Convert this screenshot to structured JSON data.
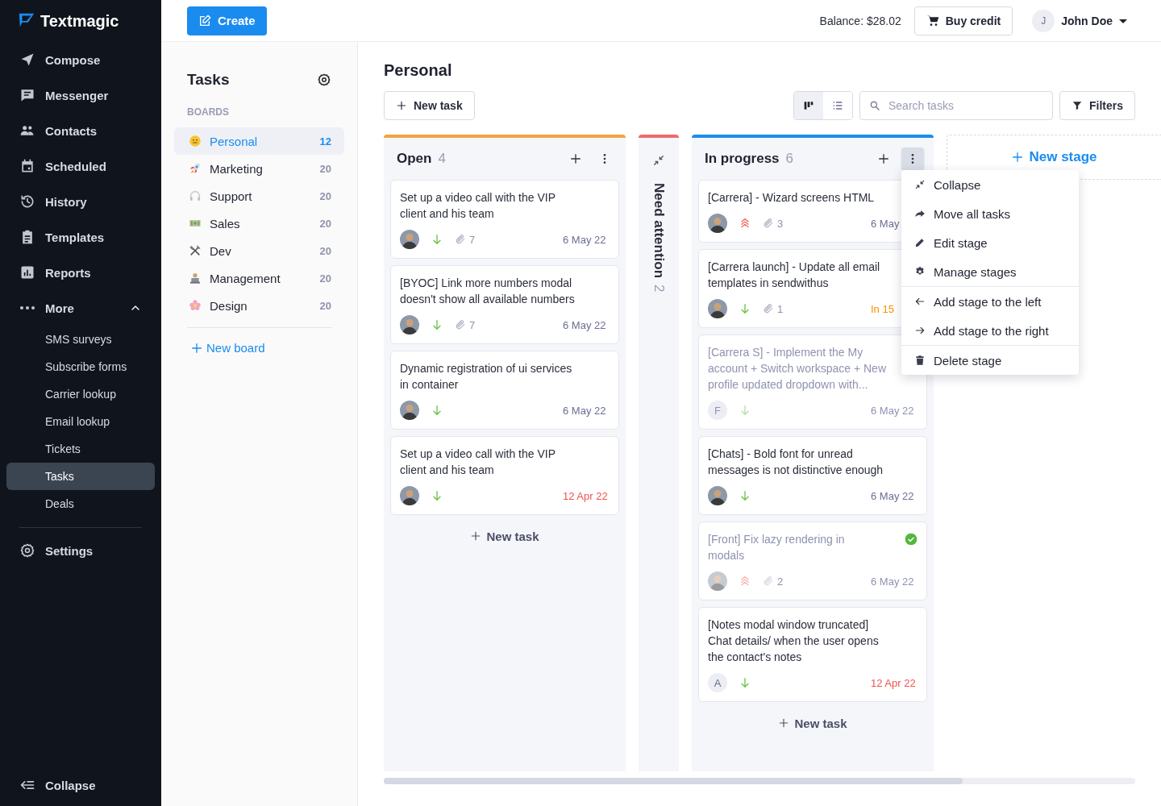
{
  "sidebar": {
    "logo": "Textmagic",
    "items": [
      {
        "label": "Compose",
        "selected": false
      },
      {
        "label": "Messenger",
        "selected": false
      },
      {
        "label": "Contacts",
        "selected": false
      },
      {
        "label": "Scheduled",
        "selected": false
      },
      {
        "label": "History",
        "selected": false
      },
      {
        "label": "Templates",
        "selected": false
      },
      {
        "label": "Reports",
        "selected": false
      },
      {
        "label": "More",
        "selected": false,
        "expanded": true,
        "children": [
          {
            "label": "SMS surveys",
            "selected": false
          },
          {
            "label": "Subscribe forms",
            "selected": false
          },
          {
            "label": "Carrier lookup",
            "selected": false
          },
          {
            "label": "Email lookup",
            "selected": false
          },
          {
            "label": "Tickets",
            "selected": false
          },
          {
            "label": "Tasks",
            "selected": true
          },
          {
            "label": "Deals",
            "selected": false
          }
        ]
      }
    ],
    "settings": "Settings",
    "collapse": "Collapse"
  },
  "topbar": {
    "create": "Create",
    "balance": "Balance: $28.02",
    "buy_credit": "Buy credit",
    "user": {
      "initial": "J",
      "name": "John Doe"
    }
  },
  "boards_panel": {
    "title": "Tasks",
    "section": "BOARDS",
    "boards": [
      {
        "name": "Personal",
        "count": "12",
        "selected": true
      },
      {
        "name": "Marketing",
        "count": "20",
        "selected": false
      },
      {
        "name": "Support",
        "count": "20",
        "selected": false
      },
      {
        "name": "Sales",
        "count": "20",
        "selected": false
      },
      {
        "name": "Dev",
        "count": "20",
        "selected": false
      },
      {
        "name": "Management",
        "count": "20",
        "selected": false
      },
      {
        "name": "Design",
        "count": "20",
        "selected": false
      }
    ],
    "new_board": "New board"
  },
  "board": {
    "title": "Personal",
    "new_task": "New task",
    "views": [
      {
        "selected": true
      },
      {
        "selected": false
      }
    ],
    "search": {
      "placeholder": "Search tasks"
    },
    "filters": "Filters",
    "columns": [
      {
        "name": "Open",
        "count": "4",
        "color": "#f2a241",
        "collapsed": false,
        "menu_open": false,
        "new_task": "New task",
        "cards": [
          {
            "title": "Set up a video call with the VIP client and his team",
            "assignee": {
              "kind": "photo"
            },
            "high_priority": false,
            "attachments": "7",
            "date": "6 May 22",
            "overdue": false,
            "due_soon": false,
            "dimmed": false,
            "completed": false
          },
          {
            "title": "[BYOC] Link more numbers modal doesn't show all available numbers",
            "assignee": {
              "kind": "photo"
            },
            "high_priority": false,
            "attachments": "7",
            "date": "6 May 22",
            "overdue": false,
            "due_soon": false,
            "dimmed": false,
            "completed": false
          },
          {
            "title": "Dynamic registration of ui services in container",
            "assignee": {
              "kind": "photo"
            },
            "high_priority": false,
            "date": "6 May 22",
            "overdue": false,
            "due_soon": false,
            "dimmed": false,
            "completed": false
          },
          {
            "title": "Set up a video call with the VIP client and his team",
            "assignee": {
              "kind": "photo"
            },
            "high_priority": false,
            "date": "12 Apr 22",
            "overdue": true,
            "due_soon": false,
            "dimmed": false,
            "completed": false
          }
        ]
      },
      {
        "name": "Need attention",
        "count": "2",
        "color": "#ef6b6b",
        "collapsed": true
      },
      {
        "name": "In progress",
        "count": "6",
        "color": "#1a8cf0",
        "collapsed": false,
        "menu_open": true,
        "new_task": "New task",
        "cards": [
          {
            "title": "[Carrera] - Wizard screens HTML",
            "assignee": {
              "kind": "photo"
            },
            "high_priority": true,
            "attachments": "3",
            "date": "6 May",
            "overdue": false,
            "due_soon": false,
            "dimmed": false,
            "completed": false
          },
          {
            "title": "[Carrera launch] - Update all email templates in sendwithus",
            "assignee": {
              "kind": "photo"
            },
            "high_priority": false,
            "attachments": "1",
            "date": "In 15",
            "overdue": false,
            "due_soon": true,
            "dimmed": false,
            "completed": false
          },
          {
            "title": "[Carrera S] - Implement the My account + Switch workspace + New profile updated dropdown with...",
            "assignee": {
              "kind": "letter",
              "initial": "F"
            },
            "high_priority": false,
            "date": "6 May 22",
            "overdue": false,
            "due_soon": false,
            "dimmed": true,
            "completed": false
          },
          {
            "title": "[Chats] - Bold font for unread messages is not distinctive enough",
            "assignee": {
              "kind": "photo"
            },
            "high_priority": false,
            "date": "6 May 22",
            "overdue": false,
            "due_soon": false,
            "dimmed": false,
            "completed": false
          },
          {
            "title": "[Front] Fix lazy rendering in modals",
            "assignee": {
              "kind": "photo"
            },
            "high_priority": true,
            "attachments": "2",
            "date": "6 May 22",
            "overdue": false,
            "due_soon": false,
            "dimmed": true,
            "completed": true
          },
          {
            "title": "[Notes modal window truncated] Chat details/ when the user opens the contact's notes",
            "assignee": {
              "kind": "letter",
              "initial": "A"
            },
            "high_priority": false,
            "date": "12 Apr 22",
            "overdue": true,
            "due_soon": false,
            "dimmed": false,
            "completed": false
          }
        ]
      }
    ],
    "stage_menu": {
      "groups": [
        {
          "items": [
            {
              "label": "Collapse"
            },
            {
              "label": "Move all tasks"
            },
            {
              "label": "Edit stage"
            },
            {
              "label": "Manage stages"
            }
          ]
        },
        {
          "items": [
            {
              "label": "Add stage to the left"
            },
            {
              "label": "Add stage to the right"
            }
          ]
        },
        {
          "items": [
            {
              "label": "Delete stage"
            }
          ]
        }
      ]
    },
    "new_stage": "New stage"
  }
}
